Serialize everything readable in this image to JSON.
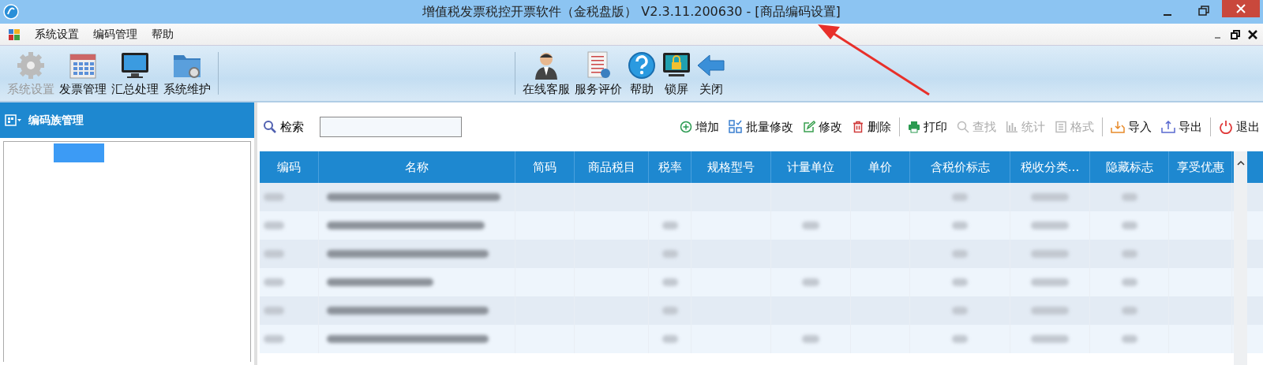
{
  "window": {
    "title": "增值税发票税控开票软件（金税盘版） V2.3.11.200630 - [商品编码设置]"
  },
  "menu": [
    "系统设置",
    "编码管理",
    "帮助"
  ],
  "toolbar_left": [
    {
      "label": "系统设置",
      "disabled": true,
      "kind": "gear"
    },
    {
      "label": "发票管理",
      "disabled": false,
      "kind": "calendar"
    },
    {
      "label": "汇总处理",
      "disabled": false,
      "kind": "monitor"
    },
    {
      "label": "系统维护",
      "disabled": false,
      "kind": "folder"
    }
  ],
  "toolbar_right": [
    {
      "label": "在线客服",
      "kind": "person"
    },
    {
      "label": "服务评价",
      "kind": "notebook"
    },
    {
      "label": "帮助",
      "kind": "help"
    },
    {
      "label": "锁屏",
      "kind": "lock"
    },
    {
      "label": "关闭",
      "kind": "back"
    }
  ],
  "sidebar": {
    "title": "编码族管理"
  },
  "search": {
    "label": "检索"
  },
  "actions": [
    {
      "label": "增加",
      "kind": "add",
      "disabled": false
    },
    {
      "label": "批量修改",
      "kind": "grid",
      "disabled": false
    },
    {
      "label": "修改",
      "kind": "edit",
      "disabled": false
    },
    {
      "label": "删除",
      "kind": "trash",
      "disabled": false
    },
    {
      "label": "打印",
      "kind": "print",
      "disabled": false
    },
    {
      "label": "查找",
      "kind": "search",
      "disabled": true
    },
    {
      "label": "统计",
      "kind": "chart",
      "disabled": true
    },
    {
      "label": "格式",
      "kind": "format",
      "disabled": true
    },
    {
      "label": "导入",
      "kind": "import",
      "disabled": false
    },
    {
      "label": "导出",
      "kind": "export",
      "disabled": false
    },
    {
      "label": "退出",
      "kind": "power",
      "disabled": false
    }
  ],
  "table": {
    "columns": [
      "编码",
      "名称",
      "简码",
      "商品税目",
      "税率",
      "规格型号",
      "计量单位",
      "单价",
      "含税价标志",
      "税收分类...",
      "隐藏标志",
      "享受优惠"
    ],
    "rows": [
      {
        "kind": "blurred"
      },
      {
        "kind": "blurred"
      },
      {
        "kind": "blurred"
      },
      {
        "kind": "blurred"
      },
      {
        "kind": "blurred"
      },
      {
        "kind": "blurred"
      }
    ]
  },
  "annotation": {
    "kind": "arrow"
  }
}
